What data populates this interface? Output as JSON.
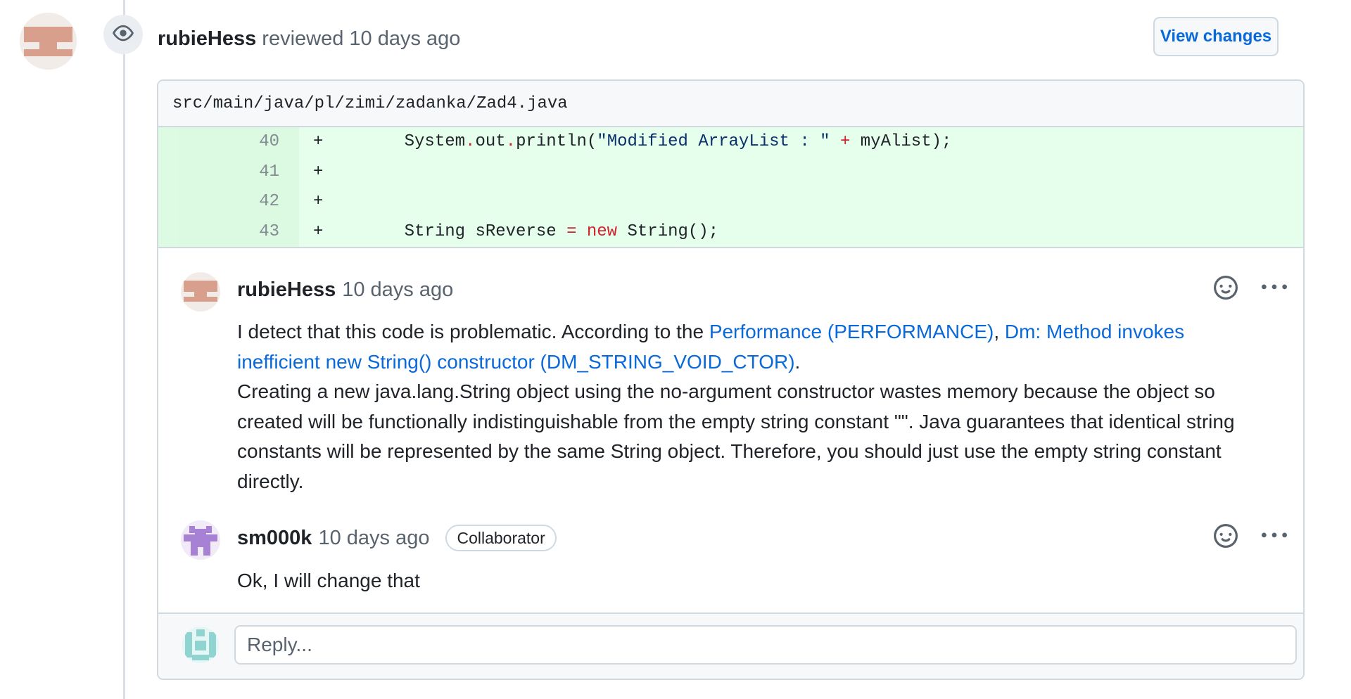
{
  "review": {
    "author": "rubieHess",
    "action": "reviewed",
    "time": "10 days ago",
    "view_changes_label": "View changes"
  },
  "file": {
    "path": "src/main/java/pl/zimi/zadanka/Zad4.java",
    "lines": [
      {
        "num": "40",
        "sign": "+"
      },
      {
        "num": "41",
        "sign": "+"
      },
      {
        "num": "42",
        "sign": "+"
      },
      {
        "num": "43",
        "sign": "+"
      }
    ],
    "code": {
      "l40": {
        "a": "System",
        "b": ".",
        "c": "out",
        "d": ".",
        "e": "println(",
        "f": "\"Modified ArrayList : \"",
        "g": " + ",
        "h": "myAlist);"
      },
      "l43": {
        "a": "String sReverse ",
        "b": "=",
        "c": " ",
        "d": "new",
        "e": " String();"
      }
    }
  },
  "comments": [
    {
      "author": "rubieHess",
      "time": "10 days ago",
      "intro": "I detect that this code is problematic. According to the ",
      "link1": "Performance (PERFORMANCE)",
      "sep": ", ",
      "link2": "Dm: Method invokes inefficient new String() constructor (DM_STRING_VOID_CTOR)",
      "end": ".",
      "detail": "Creating a new java.lang.String object using the no-argument constructor wastes memory because the object so created will be functionally indistinguishable from the empty string constant \"\".  Java guarantees that identical string constants will be represented by the same String object.  Therefore, you should just use the empty string constant directly."
    },
    {
      "author": "sm000k",
      "time": "10 days ago",
      "badge": "Collaborator",
      "body": "Ok, I will change that"
    }
  ],
  "reply": {
    "placeholder": "Reply..."
  },
  "icons": {
    "review_badge": "eye-icon",
    "reaction": "smiley-icon",
    "menu": "kebab-horizontal-icon"
  },
  "colors": {
    "link": "#0969da",
    "diff_add_bg": "#e6ffec",
    "diff_add_num_bg": "#d1f8d9",
    "keyword": "#cf222e"
  }
}
